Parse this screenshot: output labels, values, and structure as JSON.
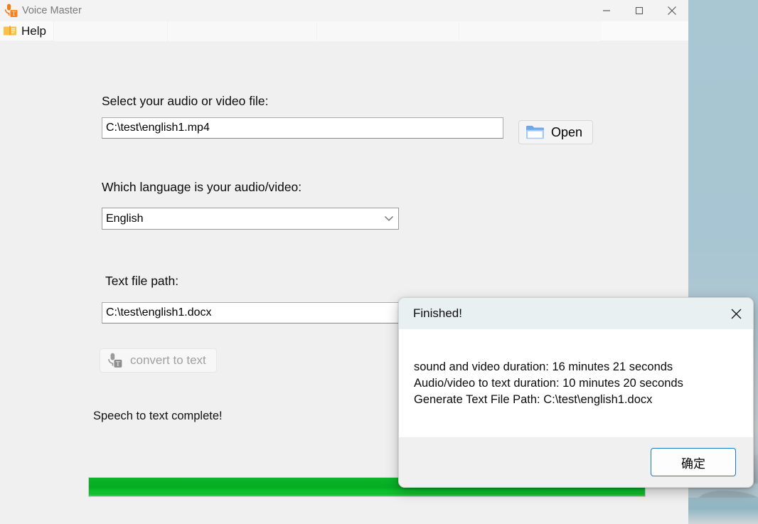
{
  "window": {
    "title": "Voice Master",
    "app_icon": "mic-text-icon",
    "controls": {
      "minimize": "—",
      "maximize": "☐",
      "close": "✕"
    }
  },
  "menu": {
    "help_label": "Help",
    "help_icon": "book-icon"
  },
  "form": {
    "file_label": "Select your audio or video file:",
    "file_value": "C:\\test\\english1.mp4",
    "open_label": "Open",
    "open_icon": "folder-icon",
    "language_label": "Which language is your audio/video:",
    "language_value": "English",
    "language_chevron": "chevron-down-icon",
    "textpath_label": "Text file path:",
    "textpath_value": "C:\\test\\english1.docx",
    "convert_label": "convert to text",
    "convert_icon": "mic-text-icon",
    "status_text": "Speech to text complete!",
    "progress_percent": 100,
    "progress_color": "#06ab22"
  },
  "dialog": {
    "title": "Finished!",
    "close_icon": "close-icon",
    "lines": [
      "sound and video duration:  16 minutes 21 seconds",
      "Audio/video to text duration: 10 minutes 20 seconds",
      "Generate Text File Path: C:\\test\\english1.docx"
    ],
    "ok_label": "确定",
    "accent_color": "#1a7bc4"
  }
}
